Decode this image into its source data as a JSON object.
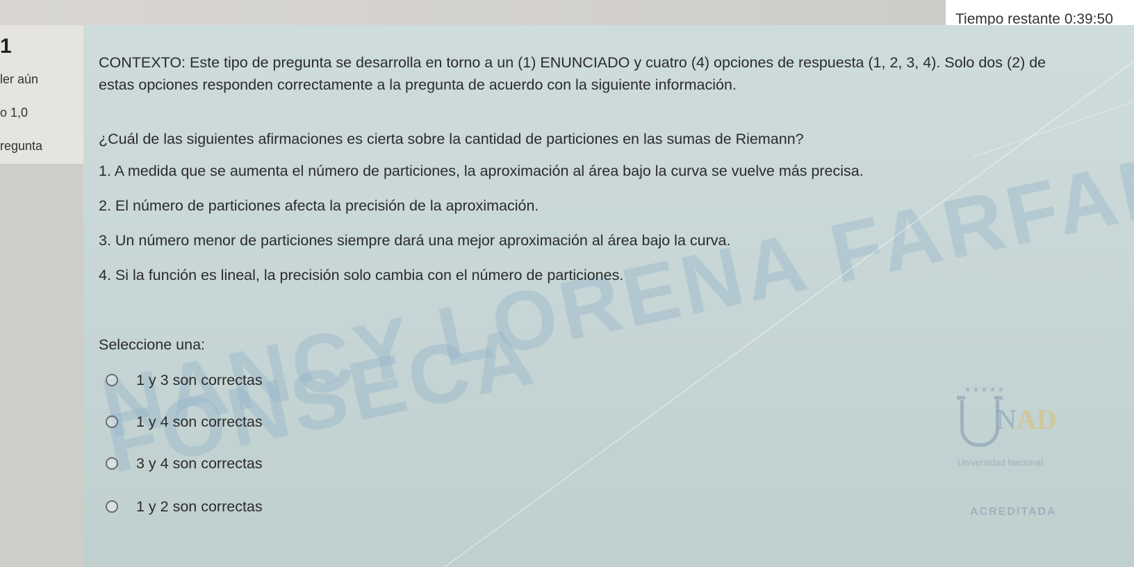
{
  "timer": {
    "label": "Tiempo restante",
    "value": "0:39:50"
  },
  "info": {
    "question_number": "1",
    "state": "ler aún",
    "score": "o 1,0",
    "flag": "regunta"
  },
  "question": {
    "context": "CONTEXTO: Este tipo de pregunta se desarrolla en torno a un (1) ENUNCIADO y cuatro (4) opciones de respuesta (1, 2, 3, 4). Solo dos (2) de estas opciones responden correctamente a la pregunta de acuerdo con la siguiente información.",
    "ask": "¿Cuál de las siguientes afirmaciones es cierta sobre la cantidad de particiones en las sumas de Riemann?",
    "statements": [
      "1. A medida que se aumenta el número de particiones, la aproximación al área bajo la curva se vuelve más precisa.",
      "2. El número de particiones afecta la precisión de la aproximación.",
      "3. Un número menor de particiones siempre dará una mejor aproximación al área bajo la curva.",
      "4. Si la función es lineal, la precisión solo cambia con el número de particiones."
    ],
    "prompt": "Seleccione una:",
    "answers": [
      "1 y 3 son correctas",
      "1 y 4 son correctas",
      "3 y 4 son correctas",
      "1 y 2 son correctas"
    ]
  },
  "watermark": {
    "line1": "NANCY LORENA FARFAN",
    "line2": "FONSECA"
  },
  "logo": {
    "letters_a": "N",
    "letters_b": "AD",
    "subtitle": "Universidad Nacional",
    "accredited": "ACREDITADA"
  },
  "colors": {
    "content_bg": "#cfdcdc",
    "timer_bg": "#ffffff",
    "text": "#2b2b2b"
  }
}
